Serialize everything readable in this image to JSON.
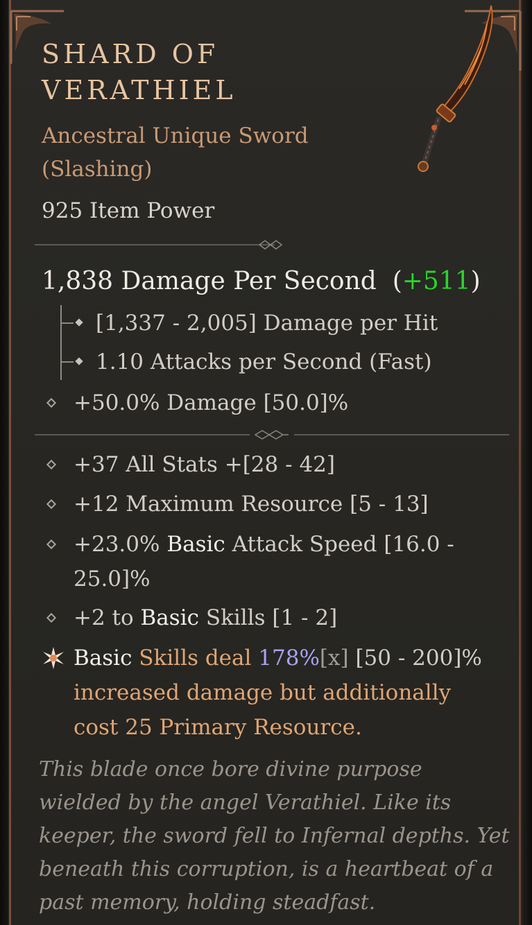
{
  "item": {
    "name_line1": "SHARD OF",
    "name_line2": "VERATHIEL",
    "type_line1": "Ancestral Unique Sword",
    "type_line2": "(Slashing)",
    "item_power": "925 Item Power"
  },
  "damage": {
    "dps": "1,838 Damage Per Second",
    "dps_open": "(",
    "dps_delta": "+511",
    "dps_close": ")",
    "per_hit": "[1,337 - 2,005] Damage per Hit",
    "attack_speed": "1.10 Attacks per Second (Fast)",
    "implicit": "+50.0% Damage [50.0]%"
  },
  "affixes": {
    "all_stats": "+37 All Stats +[28 - 42]",
    "max_resource": "+12 Maximum Resource [5 - 13]",
    "attack_speed_pre": "+23.0% ",
    "attack_speed_hl": "Basic",
    "attack_speed_post": " Attack Speed [16.0 -",
    "attack_speed_line2": "25.0]%",
    "skills_pre": "+2 to ",
    "skills_hl": "Basic",
    "skills_post": " Skills [1 - 2]"
  },
  "unique_power": {
    "w1": "Basic",
    "w2": " Skills deal ",
    "value": "178%",
    "mult": "[x]",
    "range": " [50 - 200]%",
    "line2": "increased damage but additionally",
    "line3": "cost 25 Primary Resource."
  },
  "flavor": "This blade once bore divine purpose wielded by the angel Verathiel. Like its keeper, the sword fell to Infernal depths. Yet beneath this corruption, is a heartbeat of a past memory, holding steadfast.",
  "colors": {
    "title": "#e7c4a1",
    "unique": "#e0a573",
    "positive": "#28d62a",
    "multiplier": "#a8a3f2"
  }
}
